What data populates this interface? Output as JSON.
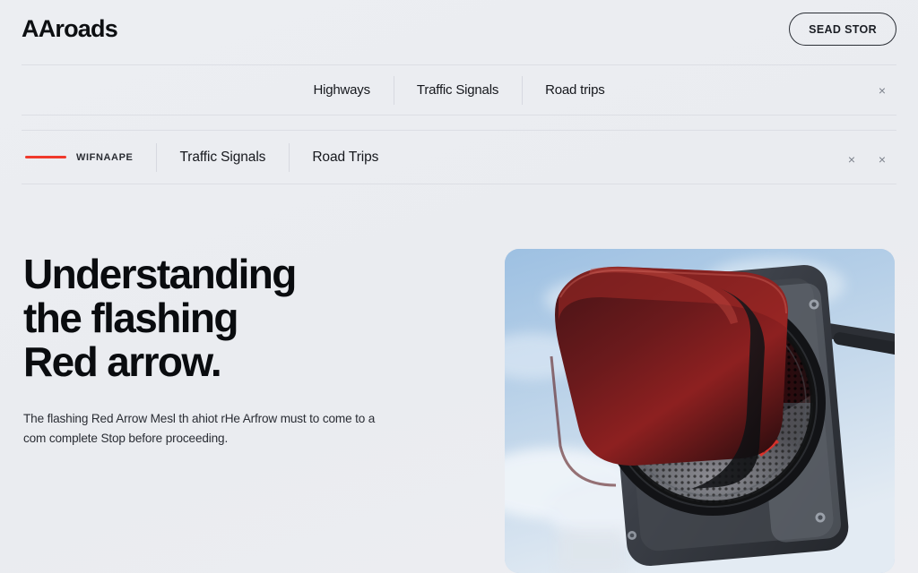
{
  "header": {
    "brand": "AAroads",
    "store_button": "SEAD STOR"
  },
  "primary_nav": {
    "items": [
      {
        "label": "Highways"
      },
      {
        "label": "Traffic Signals"
      },
      {
        "label": "Road trips"
      }
    ],
    "close_icon": "×"
  },
  "secondary_nav": {
    "brand_mark_label": "WIFNAAPE",
    "items": [
      {
        "label": "Traffic Signals"
      },
      {
        "label": "Road Trips"
      }
    ],
    "close_icon_1": "×",
    "close_icon_2": "×"
  },
  "hero": {
    "headline_line_1": "Understanding",
    "headline_line_2": "the flashing",
    "headline_line_3": "Red arrow.",
    "body": "The flashing Red Arrow Mesl th ahiot rHe Arfrow must to come to a com complete Stop before proceeding.",
    "image_alt": "red-led-arrow-traffic-signal"
  },
  "colors": {
    "background": "#ecedf1",
    "accent_red": "#f0392c",
    "text_primary": "#0a0c0f",
    "divider": "#dcdee4"
  }
}
